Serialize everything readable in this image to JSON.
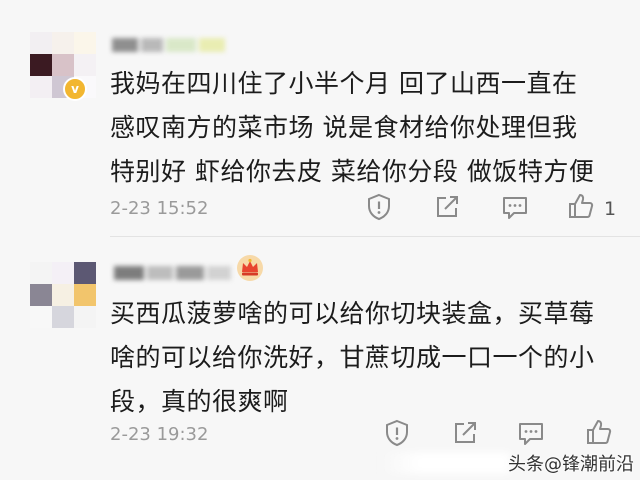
{
  "comments": [
    {
      "text_lines": [
        "我妈在四川住了小半个月 回了山西一直在",
        "感叹南方的菜市场 说是食材给你处理但我",
        "特别好 虾给你去皮 菜给你分段 做饭特方便"
      ],
      "time": "2-23 15:52",
      "like_count": "1",
      "badge_symbol": "v",
      "colors": {
        "avatar": [
          "#f2eff2",
          "#f6f1ec",
          "#fbf6ea",
          "#3b1a22",
          "#d8c2c8",
          "#f4f1f4",
          "#f3eff3",
          "#cfc7d3",
          "#faf9fb"
        ],
        "name_blur": [
          "#8f8f8f",
          "#b9b9b9",
          "#d9e8c8",
          "#e9edb2"
        ]
      }
    },
    {
      "text_lines": [
        "买西瓜菠萝啥的可以给你切块装盒，买草莓",
        "啥的可以给你洗好，甘蔗切成一口一个的小",
        "段，真的很爽啊"
      ],
      "time": "2-23 19:32",
      "like_count": "",
      "colors": {
        "avatar": [
          "#f4f4f4",
          "#f4f0f6",
          "#5c5873",
          "#8a8694",
          "#f6f0e3",
          "#f2c56c",
          "#f8f8f8",
          "#d6d6dd",
          "#f4f4f4"
        ],
        "name_blur": [
          "#7d7d7d",
          "#bdbdbd",
          "#9a9a9a",
          "#d2d2d2"
        ]
      }
    }
  ],
  "icons": {
    "report": "report-shield-icon",
    "share": "share-icon",
    "reply": "comment-icon",
    "like": "thumbs-up-icon",
    "crown": "crown-icon"
  },
  "watermark": {
    "text": "头条@锋潮前沿"
  },
  "colors": {
    "background": "#f7f7f7",
    "text": "#1c1c1c",
    "time": "#9a9a9a",
    "icon": "#8a8a8a",
    "badge": "#f2b630",
    "crown": "#e8442f"
  }
}
